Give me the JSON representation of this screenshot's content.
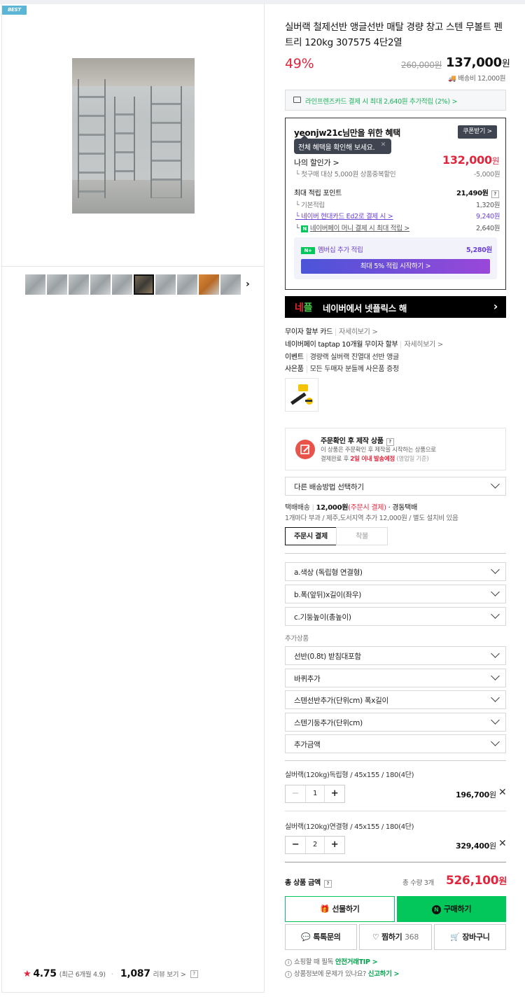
{
  "badge": "BEST",
  "gallery": {
    "next": "›",
    "rating_score": "4.75",
    "rating_sub": "(최근 6개월 4.9)",
    "review_count": "1,087",
    "review_link": "리뷰 보기 >",
    "help": "?"
  },
  "product": {
    "title": "실버랙 철제선반 앵글선반 매탈 경량 창고 스텐 무볼트 펜트리 120kg 307575 4단2열",
    "discount": "49%",
    "old_price": "260,000원",
    "price": "137,000",
    "price_unit": "원",
    "shipping": "배송비 12,000원"
  },
  "card_banner": "라인프렌즈카드 결제 시 최대 2,640원 추가적립 (2%) >",
  "benefit": {
    "user_title": "yeonjw21c님만을 위한 혜택",
    "coupon_btn": "쿠폰받기 >",
    "tooltip": "전체 혜택을 확인해 보세요.",
    "tooltip_close": "✕",
    "my_discount_label": "나의 할인가 >",
    "my_discount_price": "132,000",
    "price_unit": "원",
    "first_buy": "첫구매 대상 5,000원 상품중복할인",
    "first_buy_val": "-5,000원",
    "points_label": "최대 적립 포인트",
    "points_val": "21,490원",
    "base": "기본적립",
    "base_val": "1,320원",
    "hyundai": "네이버 현대카드 Ed2로 결제 시 >",
    "hyundai_val": "9,240원",
    "npay": "네이버페이 머니 결제 시 최대 적립 >",
    "npay_val": "2,640원",
    "membership": "멤버십 추가 적립",
    "membership_val": "5,280원",
    "membership_btn": "최대 5% 적립 시작하기 >"
  },
  "netflix": {
    "logo_a": "네",
    "logo_b": "플",
    "text": "네이버에서 넷플릭스 해",
    "arrow": "›"
  },
  "info": [
    {
      "label": "무이자 할부 카드",
      "link": "자세히보기 >"
    },
    {
      "label": "네이버페이 taptap 10개월 무이자 할부",
      "link": "자세히보기 >"
    },
    {
      "label": "이벤트",
      "link": "경량랙 실버랙 진열대 선반 앵글"
    },
    {
      "label": "사은품",
      "link": "모든 두매자 분들께 사은품 증정"
    }
  ],
  "order_notice": {
    "title": "주문확인 후 제작 상품",
    "help": "?",
    "line1": "이 상품은 주문확인 후 제작을 시작하는 상품으로",
    "line2_a": "결제완료 후 ",
    "line2_b": "2일 이내 발송예정",
    "line2_c": " (영업일 기준)"
  },
  "delivery": {
    "select": "다른 배송방법 선택하기",
    "type": "택배배송",
    "fee": "12,000원",
    "fee_note": "(주문시 결제)",
    "carrier": "· 경동택배",
    "note": "1개마다 부과 / 제주,도서지역 추가 12,000원 / 별도 설치비 있음",
    "tab1": "주문시 결제",
    "tab2": "착불"
  },
  "options": [
    "a.색상 (독립형 연결형)",
    "b.폭(앞뒤)x길이(좌우)",
    "c.기둥높이(총높이)"
  ],
  "addon_label": "추가상품",
  "addons": [
    "선반(0.8t) 받침대포함",
    "바퀴추가",
    "스텐선반추가(단위cm) 폭x길이",
    "스텐기둥추가(단위cm)",
    "추가금액"
  ],
  "items": [
    {
      "name": "실버랙(120kg)독립형 / 45x155 / 180(4단)",
      "qty": "1",
      "price": "196,700",
      "unit": "원"
    },
    {
      "name": "실버랙(120kg)연결형 / 45x155 / 180(4단)",
      "qty": "2",
      "price": "329,400",
      "unit": "원"
    }
  ],
  "total": {
    "label": "총 상품 금액",
    "help": "?",
    "qty": "총 수량 3개",
    "price": "526,100",
    "unit": "원"
  },
  "buttons": {
    "gift": "선물하기",
    "buy": "구매하기",
    "inquiry": "톡톡문의",
    "wish": "찜하기",
    "wish_count": "368",
    "cart": "장바구니"
  },
  "footer": {
    "a": "쇼핑할 때 필독",
    "a_link": "안전거래TIP >",
    "b": "상품정보에 문제가 있나요?",
    "b_link": "신고하기 >"
  },
  "colors": {
    "red": "#e0263d",
    "green": "#03c75a",
    "purple": "#6a3fd8"
  }
}
